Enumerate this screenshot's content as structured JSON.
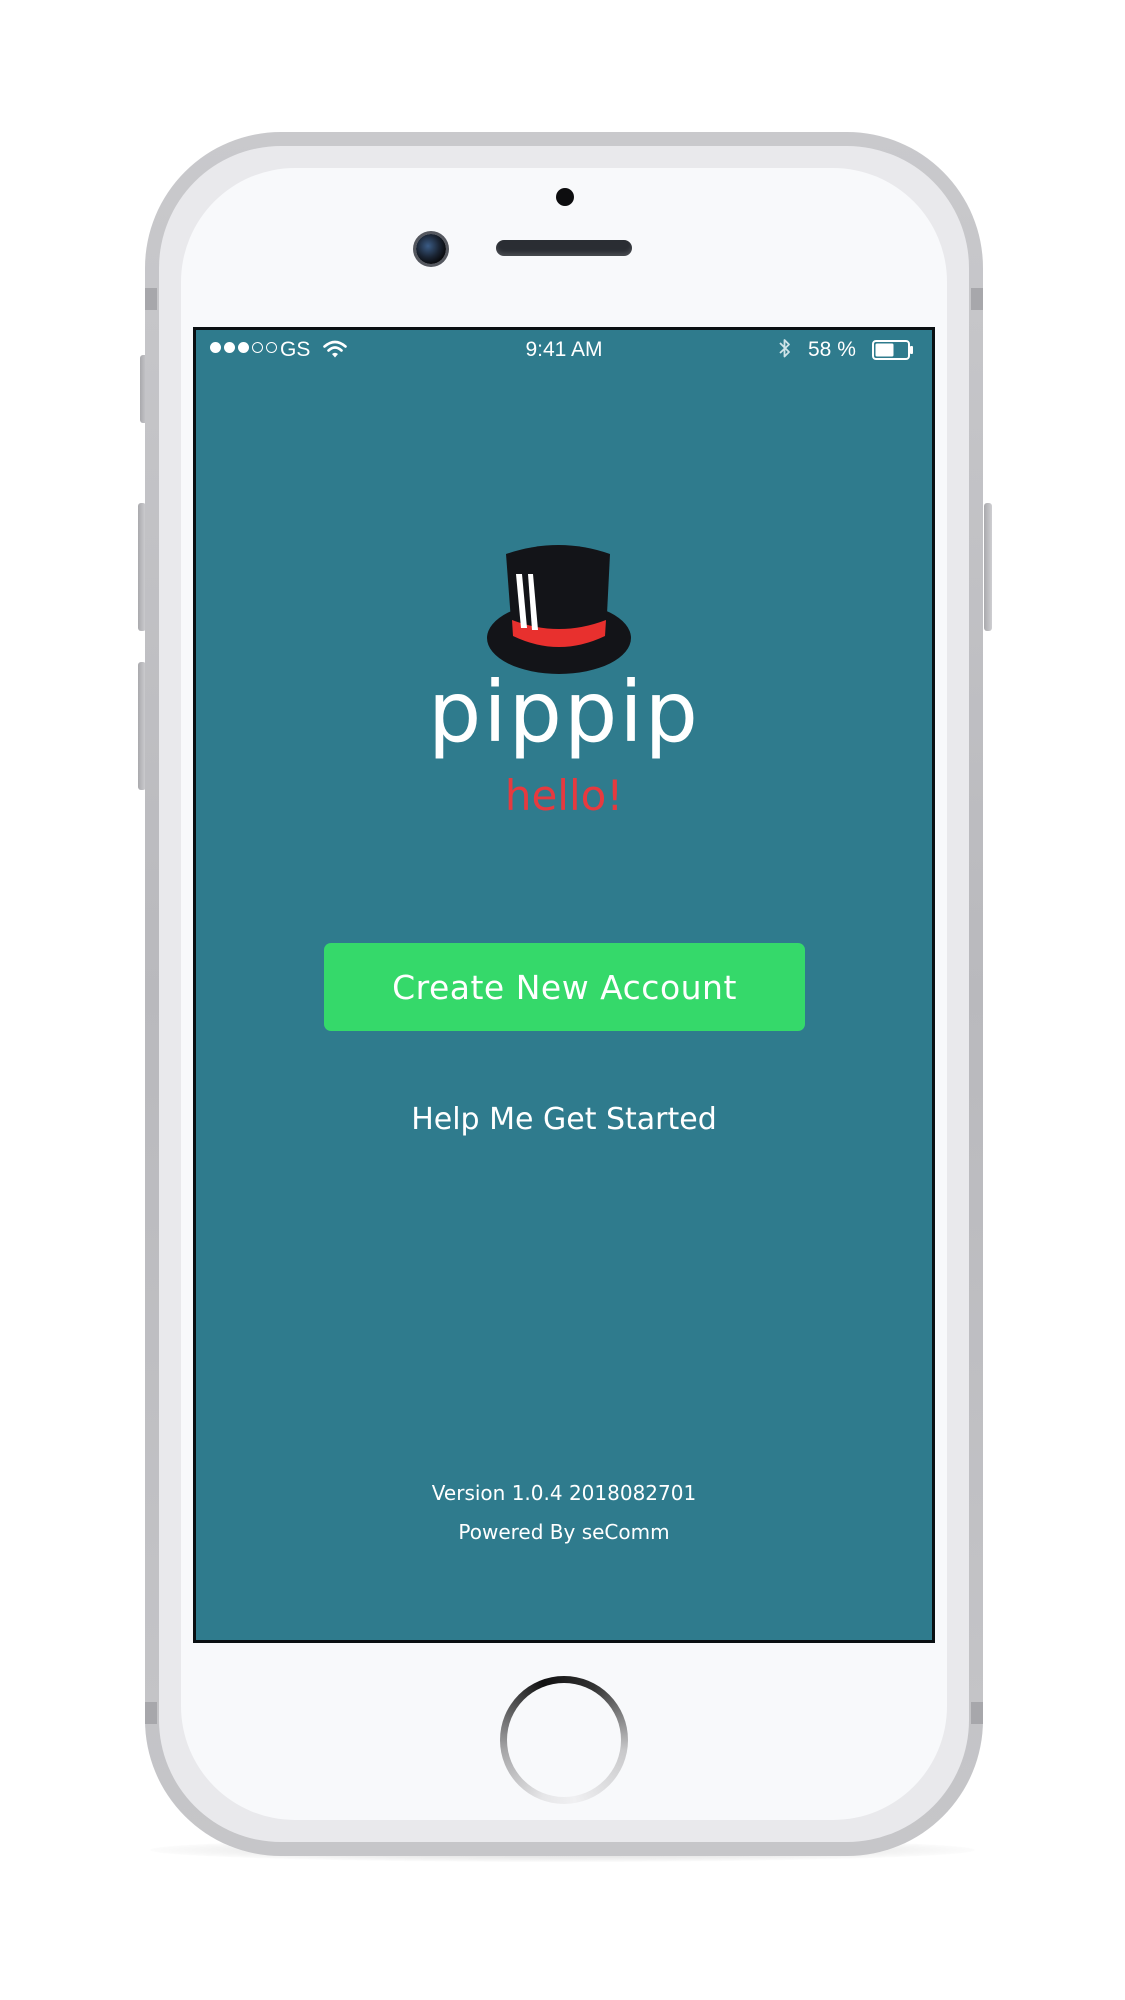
{
  "status_bar": {
    "signal_dots": [
      "on",
      "on",
      "on",
      "off",
      "off"
    ],
    "carrier": "GS",
    "time": "9:41 AM",
    "battery_percent": "58 %",
    "battery_level": 0.58,
    "icons": [
      "wifi-icon",
      "bluetooth-icon",
      "battery-icon"
    ]
  },
  "branding": {
    "logo_icon": "top-hat-icon",
    "app_name": "pippip",
    "tagline": "hello!",
    "hat_color": "#131418",
    "hat_band_color": "#e8302e"
  },
  "actions": {
    "create_account_label": "Create New Account",
    "help_label": "Help Me Get Started"
  },
  "footer": {
    "version": "Version 1.0.4 2018082701",
    "powered_by": "Powered By seComm"
  },
  "colors": {
    "screen_background": "#2f7b8d",
    "primary_button": "#35d96a",
    "tagline": "#e63a3f",
    "text": "#ffffff"
  }
}
